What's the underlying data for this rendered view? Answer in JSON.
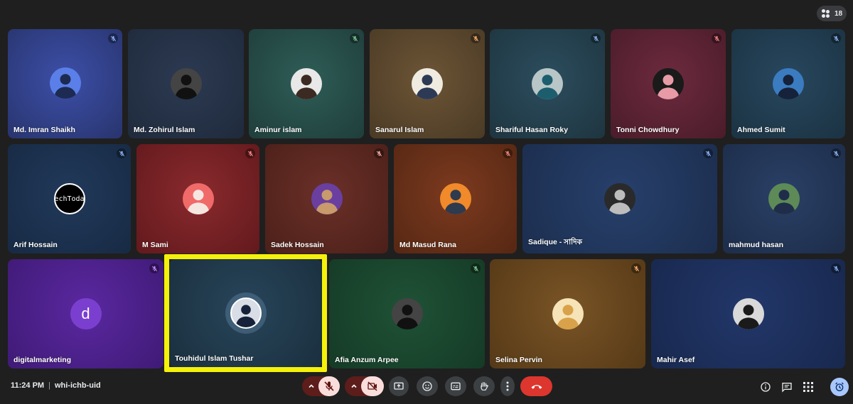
{
  "participant_count": "18",
  "tiles": [
    {
      "name": "Md. Imran Shaikh",
      "muted": true
    },
    {
      "name": "Md. Zohirul Islam",
      "muted": false
    },
    {
      "name": "Aminur islam",
      "muted": true
    },
    {
      "name": "Sanarul Islam",
      "muted": true
    },
    {
      "name": "Shariful Hasan Roky",
      "muted": true
    },
    {
      "name": "Tonni Chowdhury",
      "muted": true
    },
    {
      "name": "Ahmed Sumit",
      "muted": true
    },
    {
      "name": "Arif Hossain",
      "muted": true,
      "avatar_text": [
        "Tech",
        "Today"
      ]
    },
    {
      "name": "M Sami",
      "muted": true
    },
    {
      "name": "Sadek Hossain",
      "muted": true
    },
    {
      "name": "Md Masud Rana",
      "muted": true
    },
    {
      "name": "Sadique - সাদিক",
      "muted": true
    },
    {
      "name": "mahmud hasan",
      "muted": true
    },
    {
      "name": "digitalmarketing",
      "muted": true,
      "avatar_letter": "d"
    },
    {
      "name": "Touhidul Islam Tushar",
      "muted": false,
      "highlighted": true
    },
    {
      "name": "Afia Anzum Arpee",
      "muted": true
    },
    {
      "name": "Selina Pervin",
      "muted": true
    },
    {
      "name": "Mahir Asef",
      "muted": true
    }
  ],
  "meeting": {
    "time": "11:24 PM",
    "separator": "|",
    "code": "whi-ichb-uid"
  },
  "controls": [
    {
      "name": "mic-options",
      "icon": "chevron-up-icon"
    },
    {
      "name": "mic-toggle",
      "icon": "mic-off-icon",
      "state": "off"
    },
    {
      "name": "camera-options",
      "icon": "chevron-up-icon"
    },
    {
      "name": "camera-toggle",
      "icon": "videocam-off-icon",
      "state": "off"
    },
    {
      "name": "present",
      "icon": "present-screen-icon"
    },
    {
      "name": "reactions",
      "icon": "emoji-icon"
    },
    {
      "name": "captions",
      "icon": "captions-icon"
    },
    {
      "name": "raise-hand",
      "icon": "hand-icon"
    },
    {
      "name": "more-options",
      "icon": "more-vert-icon"
    },
    {
      "name": "leave-call",
      "icon": "call-end-icon"
    }
  ],
  "right_controls": [
    "info-icon",
    "chat-icon",
    "apps-grid-icon",
    "activities-icon"
  ],
  "colors": {
    "highlight": "#f5f10a",
    "end_call": "#dc362e",
    "muted_control": "#f9dedc",
    "background": "#1f1f1f"
  }
}
